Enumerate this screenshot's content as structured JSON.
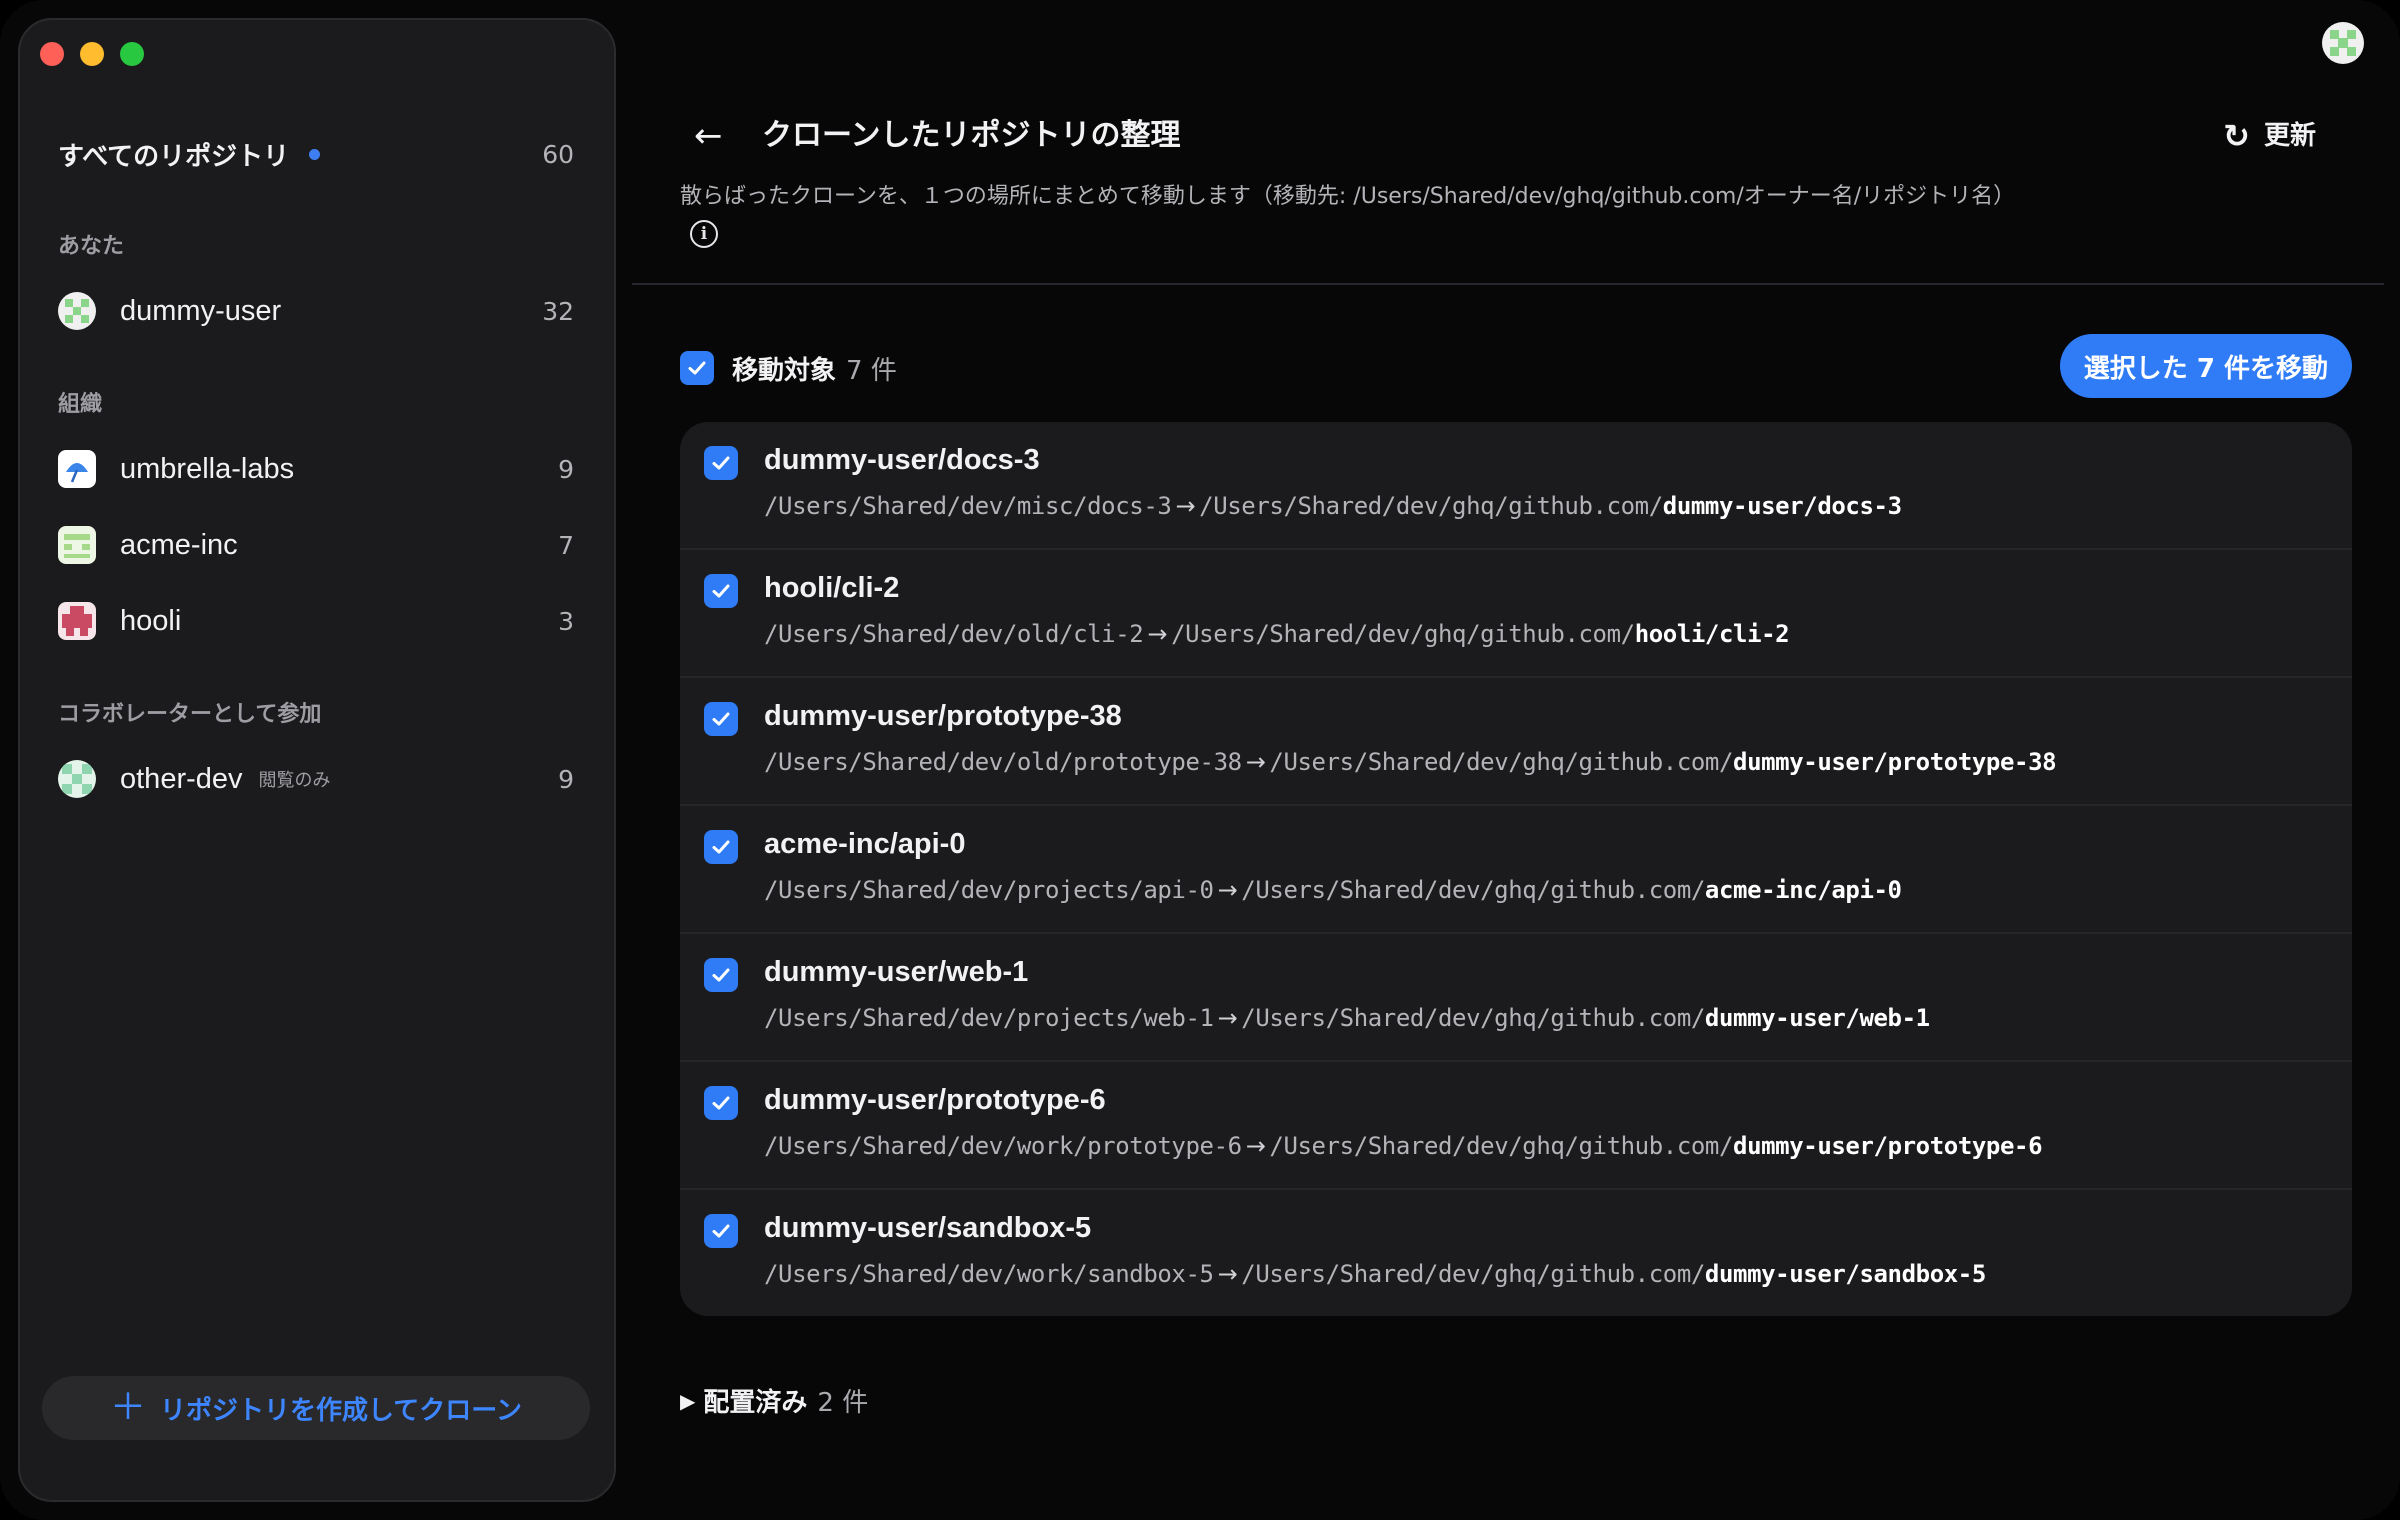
{
  "sidebar": {
    "all_repos": {
      "label": "すべてのリポジトリ",
      "count": "60"
    },
    "sections": {
      "you": "あなた",
      "orgs": "組織",
      "collab": "コラボレーターとして参加"
    },
    "you_item": {
      "name": "dummy-user",
      "count": "32"
    },
    "org_items": [
      {
        "name": "umbrella-labs",
        "count": "9"
      },
      {
        "name": "acme-inc",
        "count": "7"
      },
      {
        "name": "hooli",
        "count": "3"
      }
    ],
    "collab_item": {
      "name": "other-dev",
      "tag": "閲覧のみ",
      "count": "9"
    },
    "create_button": {
      "icon": "plus-icon",
      "label": "リポジトリを作成してクローン"
    }
  },
  "header": {
    "back_icon": "←",
    "title": "クローンしたリポジトリの整理",
    "refresh_icon": "↻",
    "refresh_label": "更新",
    "subtitle": "散らばったクローンを、１つの場所にまとめて移動します（移動先: /Users/Shared/dev/ghq/github.com/オーナー名/リポジトリ名）",
    "info_icon": "i"
  },
  "selection": {
    "label": "移動対象",
    "count_text": "7 件",
    "move_button": "選択した 7 件を移動"
  },
  "repos": [
    {
      "name": "dummy-user/docs-3",
      "from": "/Users/Shared/dev/misc/docs-3",
      "to_prefix": "/Users/Shared/dev/ghq/github.com/",
      "to_repo": "dummy-user/docs-3",
      "checked": true
    },
    {
      "name": "hooli/cli-2",
      "from": "/Users/Shared/dev/old/cli-2",
      "to_prefix": "/Users/Shared/dev/ghq/github.com/",
      "to_repo": "hooli/cli-2",
      "checked": true
    },
    {
      "name": "dummy-user/prototype-38",
      "from": "/Users/Shared/dev/old/prototype-38",
      "to_prefix": "/Users/Shared/dev/ghq/github.com/",
      "to_repo": "dummy-user/prototype-38",
      "checked": true
    },
    {
      "name": "acme-inc/api-0",
      "from": "/Users/Shared/dev/projects/api-0",
      "to_prefix": "/Users/Shared/dev/ghq/github.com/",
      "to_repo": "acme-inc/api-0",
      "checked": true
    },
    {
      "name": "dummy-user/web-1",
      "from": "/Users/Shared/dev/projects/web-1",
      "to_prefix": "/Users/Shared/dev/ghq/github.com/",
      "to_repo": "dummy-user/web-1",
      "checked": true
    },
    {
      "name": "dummy-user/prototype-6",
      "from": "/Users/Shared/dev/work/prototype-6",
      "to_prefix": "/Users/Shared/dev/ghq/github.com/",
      "to_repo": "dummy-user/prototype-6",
      "checked": true
    },
    {
      "name": "dummy-user/sandbox-5",
      "from": "/Users/Shared/dev/work/sandbox-5",
      "to_prefix": "/Users/Shared/dev/ghq/github.com/",
      "to_repo": "dummy-user/sandbox-5",
      "checked": true
    }
  ],
  "path_arrow": "→",
  "placed": {
    "triangle": "▶",
    "label": "配置済み",
    "count_text": "2 件"
  },
  "colors": {
    "accent": "#2f7cf6",
    "link": "#3d86ff",
    "dot": "#3d7ff2",
    "traffic_red": "#fe5f57",
    "traffic_yellow": "#febc2e",
    "traffic_green": "#28c840"
  }
}
